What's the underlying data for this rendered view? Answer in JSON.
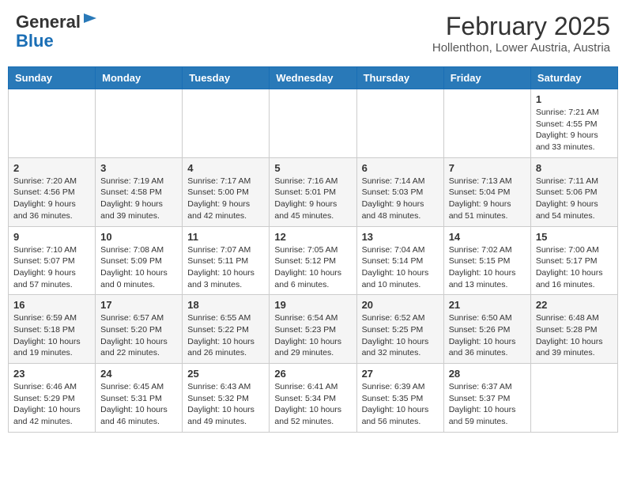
{
  "header": {
    "logo": {
      "general": "General",
      "blue": "Blue"
    },
    "title": "February 2025",
    "location": "Hollenthon, Lower Austria, Austria"
  },
  "weekdays": [
    "Sunday",
    "Monday",
    "Tuesday",
    "Wednesday",
    "Thursday",
    "Friday",
    "Saturday"
  ],
  "weeks": [
    [
      {
        "day": "",
        "info": ""
      },
      {
        "day": "",
        "info": ""
      },
      {
        "day": "",
        "info": ""
      },
      {
        "day": "",
        "info": ""
      },
      {
        "day": "",
        "info": ""
      },
      {
        "day": "",
        "info": ""
      },
      {
        "day": "1",
        "info": "Sunrise: 7:21 AM\nSunset: 4:55 PM\nDaylight: 9 hours and 33 minutes."
      }
    ],
    [
      {
        "day": "2",
        "info": "Sunrise: 7:20 AM\nSunset: 4:56 PM\nDaylight: 9 hours and 36 minutes."
      },
      {
        "day": "3",
        "info": "Sunrise: 7:19 AM\nSunset: 4:58 PM\nDaylight: 9 hours and 39 minutes."
      },
      {
        "day": "4",
        "info": "Sunrise: 7:17 AM\nSunset: 5:00 PM\nDaylight: 9 hours and 42 minutes."
      },
      {
        "day": "5",
        "info": "Sunrise: 7:16 AM\nSunset: 5:01 PM\nDaylight: 9 hours and 45 minutes."
      },
      {
        "day": "6",
        "info": "Sunrise: 7:14 AM\nSunset: 5:03 PM\nDaylight: 9 hours and 48 minutes."
      },
      {
        "day": "7",
        "info": "Sunrise: 7:13 AM\nSunset: 5:04 PM\nDaylight: 9 hours and 51 minutes."
      },
      {
        "day": "8",
        "info": "Sunrise: 7:11 AM\nSunset: 5:06 PM\nDaylight: 9 hours and 54 minutes."
      }
    ],
    [
      {
        "day": "9",
        "info": "Sunrise: 7:10 AM\nSunset: 5:07 PM\nDaylight: 9 hours and 57 minutes."
      },
      {
        "day": "10",
        "info": "Sunrise: 7:08 AM\nSunset: 5:09 PM\nDaylight: 10 hours and 0 minutes."
      },
      {
        "day": "11",
        "info": "Sunrise: 7:07 AM\nSunset: 5:11 PM\nDaylight: 10 hours and 3 minutes."
      },
      {
        "day": "12",
        "info": "Sunrise: 7:05 AM\nSunset: 5:12 PM\nDaylight: 10 hours and 6 minutes."
      },
      {
        "day": "13",
        "info": "Sunrise: 7:04 AM\nSunset: 5:14 PM\nDaylight: 10 hours and 10 minutes."
      },
      {
        "day": "14",
        "info": "Sunrise: 7:02 AM\nSunset: 5:15 PM\nDaylight: 10 hours and 13 minutes."
      },
      {
        "day": "15",
        "info": "Sunrise: 7:00 AM\nSunset: 5:17 PM\nDaylight: 10 hours and 16 minutes."
      }
    ],
    [
      {
        "day": "16",
        "info": "Sunrise: 6:59 AM\nSunset: 5:18 PM\nDaylight: 10 hours and 19 minutes."
      },
      {
        "day": "17",
        "info": "Sunrise: 6:57 AM\nSunset: 5:20 PM\nDaylight: 10 hours and 22 minutes."
      },
      {
        "day": "18",
        "info": "Sunrise: 6:55 AM\nSunset: 5:22 PM\nDaylight: 10 hours and 26 minutes."
      },
      {
        "day": "19",
        "info": "Sunrise: 6:54 AM\nSunset: 5:23 PM\nDaylight: 10 hours and 29 minutes."
      },
      {
        "day": "20",
        "info": "Sunrise: 6:52 AM\nSunset: 5:25 PM\nDaylight: 10 hours and 32 minutes."
      },
      {
        "day": "21",
        "info": "Sunrise: 6:50 AM\nSunset: 5:26 PM\nDaylight: 10 hours and 36 minutes."
      },
      {
        "day": "22",
        "info": "Sunrise: 6:48 AM\nSunset: 5:28 PM\nDaylight: 10 hours and 39 minutes."
      }
    ],
    [
      {
        "day": "23",
        "info": "Sunrise: 6:46 AM\nSunset: 5:29 PM\nDaylight: 10 hours and 42 minutes."
      },
      {
        "day": "24",
        "info": "Sunrise: 6:45 AM\nSunset: 5:31 PM\nDaylight: 10 hours and 46 minutes."
      },
      {
        "day": "25",
        "info": "Sunrise: 6:43 AM\nSunset: 5:32 PM\nDaylight: 10 hours and 49 minutes."
      },
      {
        "day": "26",
        "info": "Sunrise: 6:41 AM\nSunset: 5:34 PM\nDaylight: 10 hours and 52 minutes."
      },
      {
        "day": "27",
        "info": "Sunrise: 6:39 AM\nSunset: 5:35 PM\nDaylight: 10 hours and 56 minutes."
      },
      {
        "day": "28",
        "info": "Sunrise: 6:37 AM\nSunset: 5:37 PM\nDaylight: 10 hours and 59 minutes."
      },
      {
        "day": "",
        "info": ""
      }
    ]
  ]
}
